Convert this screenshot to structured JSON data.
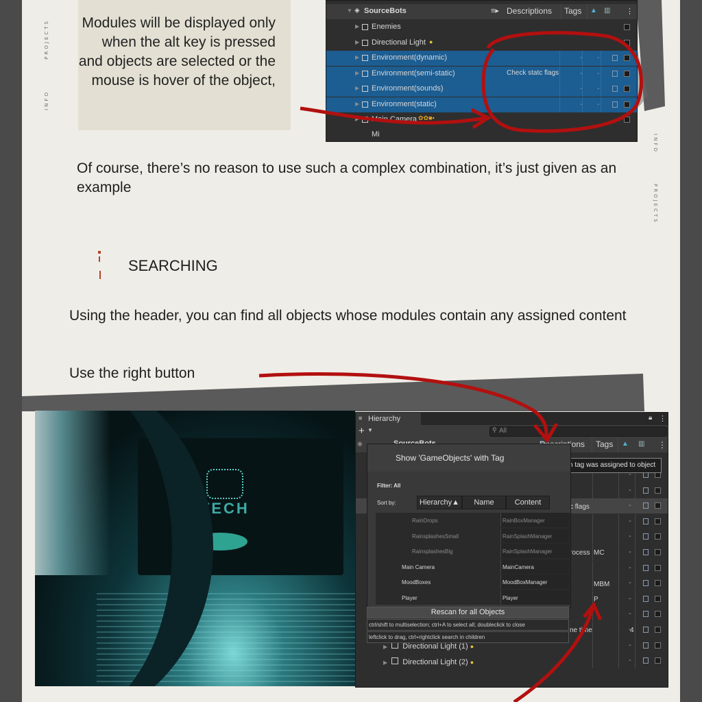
{
  "side_labels": {
    "left_top": "PROJECTS",
    "left_bottom": "INFO",
    "right_top": "INFO",
    "right_bottom": "PROJECTS"
  },
  "note": {
    "text": "Modules will be displayed only when the alt key is pressed and objects are selected or the mouse is hover of the object,"
  },
  "para1": "Of course, there’s no reason to use such a complex combination, it’s just given as an example",
  "section": {
    "title": "SEARCHING",
    "marker_color": "#b04428"
  },
  "para2": "Using the header, you can find all objects whose modules contain any assigned content",
  "para3": "Use the right button",
  "arrow_color": "#b2100f",
  "shot1": {
    "root": "SourceBots",
    "descriptions_tab": "Descriptions",
    "tags_tab": "Tags",
    "rows": [
      {
        "label": "Enemies",
        "selected": false
      },
      {
        "label": "Directional Light",
        "selected": false
      },
      {
        "label": "Environment(dynamic)",
        "selected": true
      },
      {
        "label": "Environment(semi-static)",
        "selected": true,
        "description": "Check statc flags"
      },
      {
        "label": "Environment(sounds)",
        "selected": true
      },
      {
        "label": "Environment(static)",
        "selected": true
      },
      {
        "label": "Main Camera",
        "selected": false
      }
    ],
    "cut_row": "Mi",
    "dash": "-"
  },
  "game": {
    "logo_text": "UTECH"
  },
  "hierarchy": {
    "title": "Hierarchy",
    "search_placeholder": "All",
    "plus": "+",
    "root": "SourceBots",
    "descriptions_tab": "Descriptions",
    "tags_tab": "Tags",
    "tooltip": "Which tag was assigned to object",
    "behind_texts": {
      "flags": "c flags",
      "process": "rocess",
      "mc": "MC",
      "mbm": "MBM",
      "p": "P",
      "time": "ne time",
      "four": "4"
    },
    "bottom_rows": [
      "Directional Light (1)",
      "Directional Light (2)"
    ],
    "dash": "-"
  },
  "popup": {
    "title": "Show 'GameObjects' with Tag",
    "filter": "Filter: All",
    "sort_label": "Sort by:",
    "sort_buttons": [
      "Hierarchy▲",
      "Name",
      "Content"
    ],
    "rows": [
      {
        "name": "RainDrops",
        "content": "RainBoxManager",
        "dim": true
      },
      {
        "name": "RainsplashesSmall",
        "content": "RainSplashManager",
        "dim": true
      },
      {
        "name": "RainsplashesBig",
        "content": "RainSplashManager",
        "dim": true
      },
      {
        "name": "Main Camera",
        "content": "MainCamera",
        "dim": false
      },
      {
        "name": "MoodBoxes",
        "content": "MoodBoxManager",
        "dim": false
      },
      {
        "name": "Player",
        "content": "Player",
        "dim": false
      }
    ],
    "rescan": "Rescan for all Objects",
    "hint1": "ctrl/shift to multiselection; ctrl+A to select all; doubleclick to close",
    "hint2": "leftclick to drag, ctrl+rightclick search in children"
  }
}
